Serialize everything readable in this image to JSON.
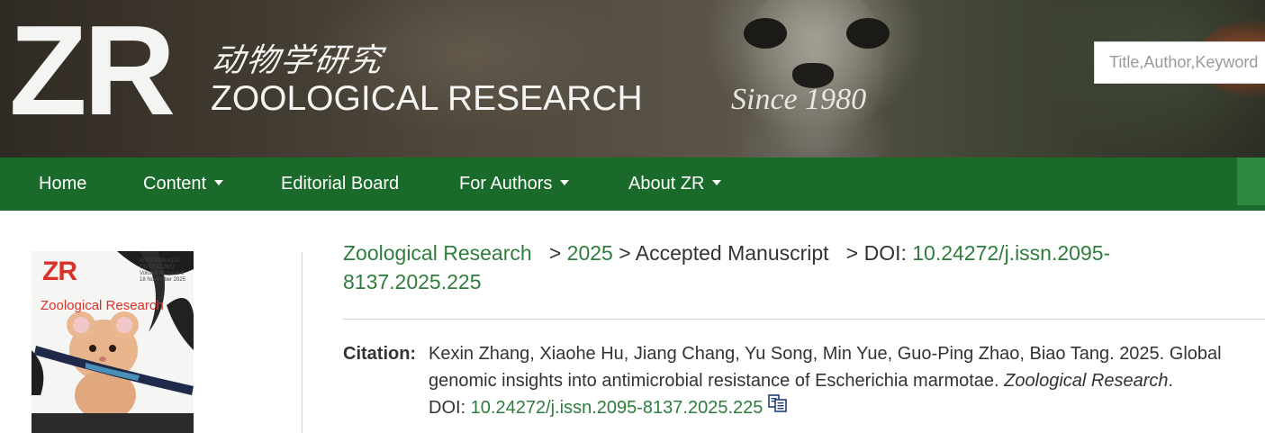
{
  "header": {
    "logo_mark": "ZR",
    "logo_chinese": "动物学研究",
    "logo_english": "ZOOLOGICAL RESEARCH",
    "tagline": "Since 1980",
    "search_placeholder": "Title,Author,Keywords"
  },
  "nav": {
    "items": [
      {
        "label": "Home",
        "has_dropdown": false
      },
      {
        "label": "Content",
        "has_dropdown": true
      },
      {
        "label": "Editorial Board",
        "has_dropdown": false
      },
      {
        "label": "For Authors",
        "has_dropdown": true
      },
      {
        "label": "About ZR",
        "has_dropdown": true
      }
    ],
    "background_color": "#1a6b2b"
  },
  "cover": {
    "logo": "ZR",
    "title": "Zoological Research"
  },
  "breadcrumb": {
    "journal": "Zoological Research",
    "year": "2025",
    "section": "Accepted Manuscript",
    "doi_prefix": "DOI:",
    "doi_part1": "10.24272/j.issn.2095-",
    "doi_part2": "8137.2025.225"
  },
  "citation": {
    "label": "Citation:",
    "line1": "Kexin Zhang, Xiaohe Hu, Jiang Chang, Yu Song, Min Yue, Guo-Ping Zhao, Biao Tang. 2025. Global",
    "line2_text": "genomic insights into antimicrobial resistance of Escherichia marmotae. ",
    "journal_italic": "Zoological Research",
    "line2_end": ".",
    "doi_label": "DOI: ",
    "doi_link": "10.24272/j.issn.2095-8137.2025.225",
    "copy_icon": "copy-icon"
  },
  "colors": {
    "link_green": "#2e7d3c",
    "nav_green": "#1a6b2b",
    "text": "#333333"
  }
}
